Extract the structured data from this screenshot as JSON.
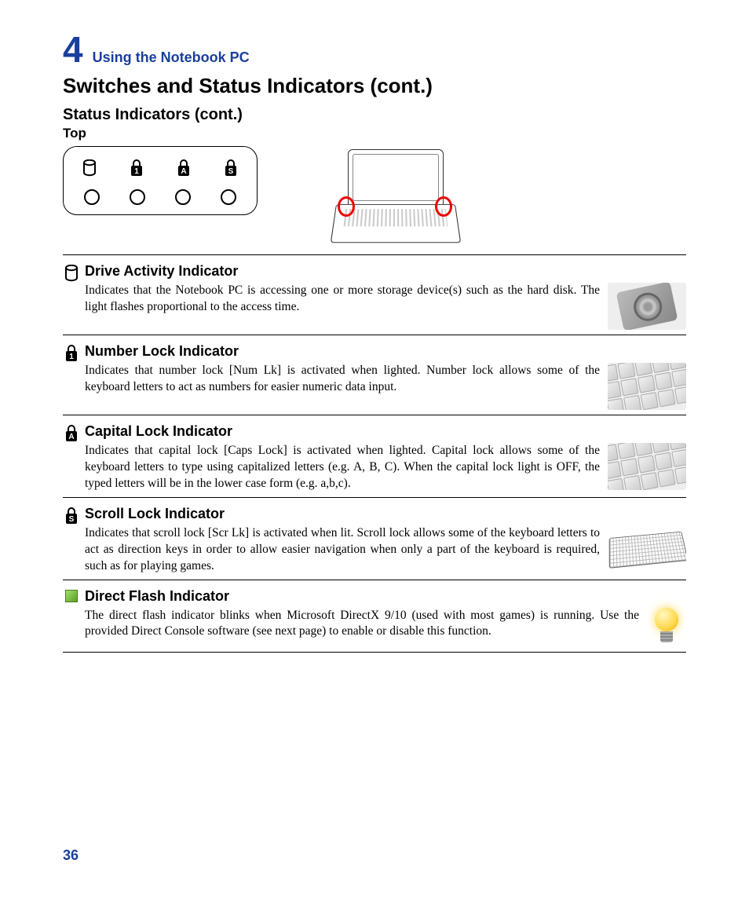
{
  "chapter": {
    "number": "4",
    "title": "Using the Notebook PC"
  },
  "headings": {
    "main": "Switches and Status Indicators (cont.)",
    "sub": "Status Indicators (cont.)",
    "sub2": "Top"
  },
  "indicators": {
    "drive": {
      "title": "Drive Activity Indicator",
      "text": "Indicates that the Notebook PC is accessing one or more storage device(s) such as the hard disk. The light flashes proportional to the access time."
    },
    "numlock": {
      "title": "Number Lock Indicator",
      "text": "Indicates that number lock [Num Lk] is activated when lighted. Number lock allows some of the  keyboard letters to act as numbers for easier numeric data input."
    },
    "capslock": {
      "title": "Capital Lock Indicator",
      "text": "Indicates that capital lock [Caps Lock] is activated when lighted. Capital lock allows some of the keyboard letters to type using capitalized letters (e.g. A, B, C). When the capital lock light is OFF, the typed letters will be in the lower case form (e.g. a,b,c)."
    },
    "scrolllock": {
      "title": "Scroll Lock Indicator",
      "text": "Indicates that scroll lock [Scr Lk] is activated when lit. Scroll lock allows some of the keyboard letters to act as direction keys in order to allow easier navigation when only a part of the keyboard is required, such as for playing games."
    },
    "directflash": {
      "title": "Direct Flash Indicator",
      "text": "The direct flash indicator blinks when Microsoft DirectX 9/10 (used with most games) is running. Use the provided Direct Console software (see next page) to enable or disable this function."
    }
  },
  "page_number": "36"
}
